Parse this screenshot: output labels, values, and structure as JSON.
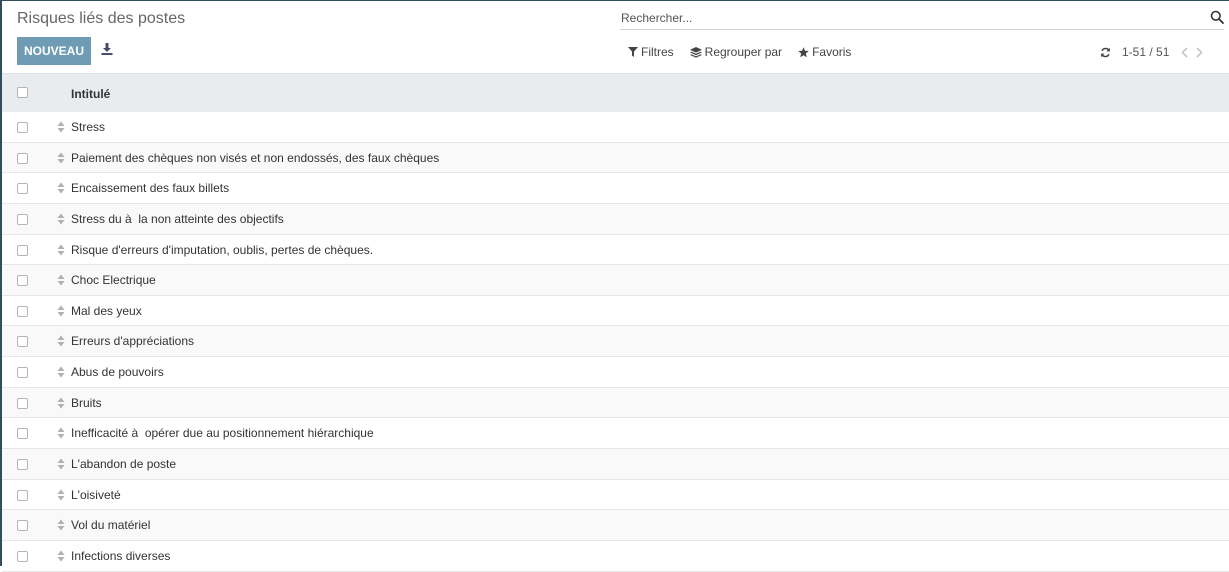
{
  "header": {
    "title": "Risques liés des postes",
    "new_button_label": "NOUVEAU"
  },
  "search": {
    "placeholder": "Rechercher..."
  },
  "filters": {
    "filters_label": "Filtres",
    "group_by_label": "Regrouper par",
    "favorites_label": "Favoris"
  },
  "pager": {
    "value": "1-51 / 51"
  },
  "list": {
    "column_title": "Intitulé",
    "rows": [
      "Stress",
      "Paiement des chèques non visés et non endossés, des faux chèques",
      "Encaissement des faux billets",
      "Stress du à  la non atteinte des objectifs",
      "Risque d'erreurs d'imputation, oublis, pertes de chèques.",
      "Choc Electrique",
      "Mal des yeux",
      "Erreurs d'appréciations",
      "Abus de pouvoirs",
      "Bruits",
      "Inefficacité à  opérer due au positionnement hiérarchique",
      "L'abandon de poste",
      "L'oisiveté",
      "Vol du matériel",
      "Infections diverses"
    ]
  },
  "colors": {
    "primary_button": "#6f9cb4",
    "header_background": "#e9ecef",
    "row_stripe": "#f9f9f9"
  },
  "icons": {
    "download": "download-icon",
    "search": "search-icon",
    "filter": "filter-icon",
    "group_by": "layers-icon",
    "favorites": "star-icon",
    "reload": "refresh-icon",
    "previous": "chevron-left-icon",
    "next": "chevron-right-icon",
    "row_handle": "sort-handle-icon"
  }
}
